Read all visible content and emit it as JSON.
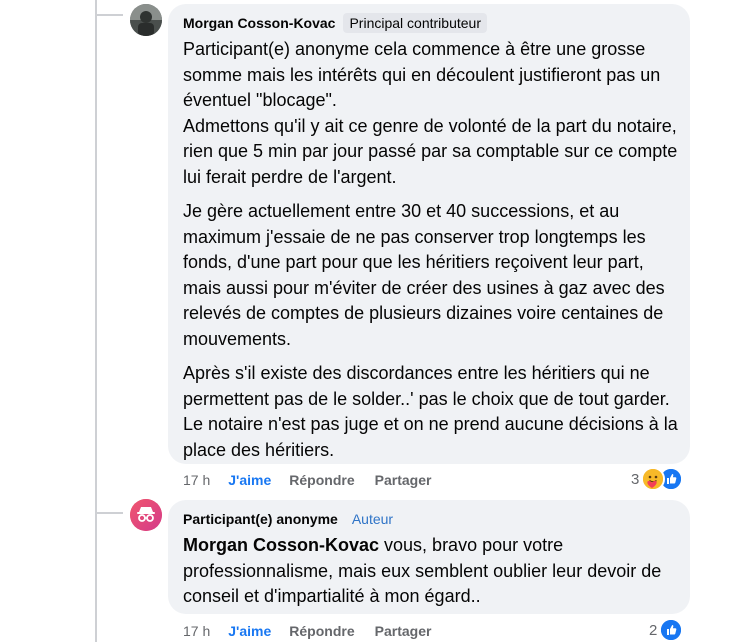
{
  "comments": [
    {
      "author": "Morgan Cosson-Kovac",
      "badge": "Principal contributeur",
      "paragraphs": [
        "Participant(e) anonyme cela commence à être une grosse somme mais les intérêts qui en découlent justifieront pas un éventuel \"blocage\".",
        "Admettons qu'il y ait ce genre de volonté de la part du notaire, rien que 5 min par jour passé par sa comptable sur ce compte lui ferait perdre de l'argent.",
        "Je gère actuellement entre 30 et 40 successions, et au maximum j'essaie de ne pas conserver trop longtemps les fonds, d'une part pour que les héritiers reçoivent leur part, mais aussi pour m'éviter de créer des usines à gaz avec des relevés de comptes de plusieurs dizaines voire centaines de mouvements.",
        "Après s'il existe des discordances entre les héritiers qui ne permettent pas de le solder..' pas le choix que de tout garder. Le notaire n'est pas juge et on ne prend aucune décisions à la place des héritiers."
      ],
      "time": "17 h",
      "like_label": "J'aime",
      "reply_label": "Répondre",
      "share_label": "Partager",
      "reaction_count": "3",
      "reactions": [
        "care-icon",
        "like-icon"
      ]
    },
    {
      "author": "Participant(e) anonyme",
      "badge": "Auteur",
      "mention": "Morgan Cosson-Kovac",
      "text": " vous, bravo pour votre professionnalisme, mais eux semblent oublier leur devoir de conseil et d'impartialité à mon égard..",
      "time": "17 h",
      "like_label": "J'aime",
      "reply_label": "Répondre",
      "share_label": "Partager",
      "reaction_count": "2",
      "reactions": [
        "like-icon"
      ]
    }
  ],
  "colors": {
    "bubble": "#f0f2f5",
    "like_blue": "#1877f2",
    "muted": "#65676b",
    "thread_line": "#ced0d4",
    "anon_avatar": "#e4405f"
  }
}
